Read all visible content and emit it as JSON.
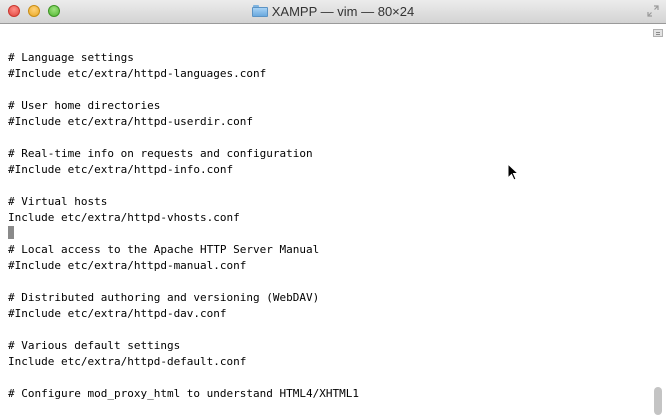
{
  "window": {
    "title": "XAMPP — vim — 80×24"
  },
  "icons": {
    "title_folder": "folder-icon",
    "fullscreen": "fullscreen-icon",
    "pointer": "mouse-pointer-icon",
    "close": "close-icon",
    "minimize": "minimize-icon",
    "zoom": "zoom-icon"
  },
  "colors": {
    "close": "#e0443e",
    "minimize": "#e9a823",
    "zoom": "#4fb630",
    "cursor": "#8a8a8a",
    "text": "#000000"
  },
  "terminal": {
    "lines": [
      "# Language settings",
      "#Include etc/extra/httpd-languages.conf",
      "",
      "# User home directories",
      "#Include etc/extra/httpd-userdir.conf",
      "",
      "# Real-time info on requests and configuration",
      "#Include etc/extra/httpd-info.conf",
      "",
      "# Virtual hosts",
      "Include etc/extra/httpd-vhosts.conf",
      "",
      "# Local access to the Apache HTTP Server Manual",
      "#Include etc/extra/httpd-manual.conf",
      "",
      "# Distributed authoring and versioning (WebDAV)",
      "#Include etc/extra/httpd-dav.conf",
      "",
      "# Various default settings",
      "Include etc/extra/httpd-default.conf",
      "",
      "# Configure mod_proxy_html to understand HTML4/XHTML1"
    ],
    "cursor_line": 11
  }
}
